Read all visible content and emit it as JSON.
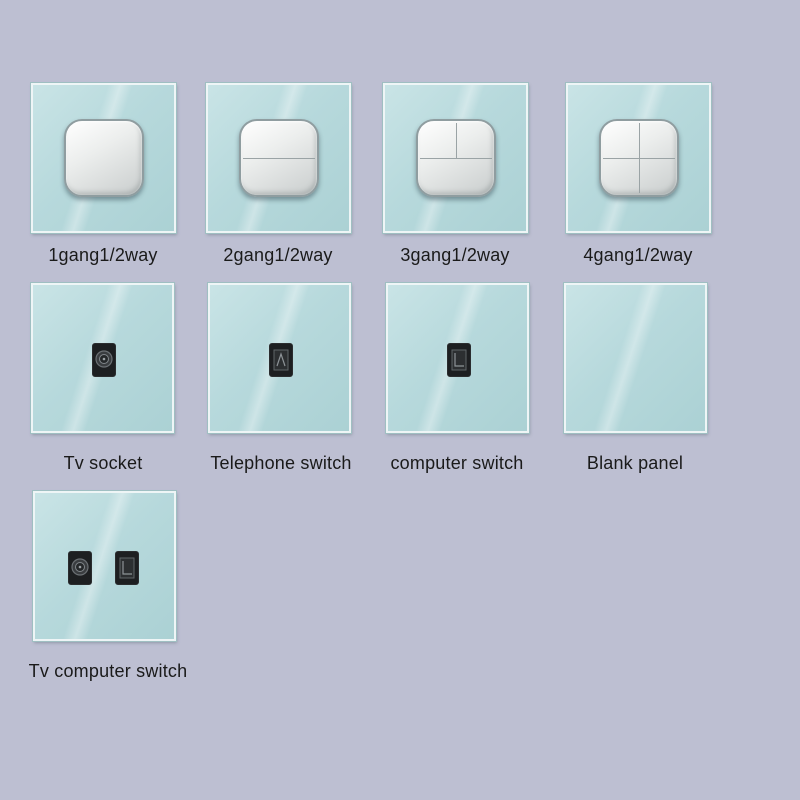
{
  "background_color": "#bdbfd2",
  "panel_color": "#b7d9dc",
  "products": [
    {
      "label": "1gang1/2way",
      "type": "switch",
      "gangs": 1
    },
    {
      "label": "2gang1/2way",
      "type": "switch",
      "gangs": 2
    },
    {
      "label": "3gang1/2way",
      "type": "switch",
      "gangs": 3
    },
    {
      "label": "4gang1/2way",
      "type": "switch",
      "gangs": 4
    },
    {
      "label": "Tv socket",
      "type": "socket",
      "ports": [
        "tv-port-icon"
      ]
    },
    {
      "label": "Telephone switch",
      "type": "socket",
      "ports": [
        "telephone-port-icon"
      ]
    },
    {
      "label": "computer switch",
      "type": "socket",
      "ports": [
        "ethernet-port-icon"
      ]
    },
    {
      "label": "Blank panel",
      "type": "blank",
      "ports": []
    },
    {
      "label": "Tv computer switch",
      "type": "socket",
      "ports": [
        "tv-port-icon",
        "ethernet-port-icon"
      ]
    }
  ]
}
